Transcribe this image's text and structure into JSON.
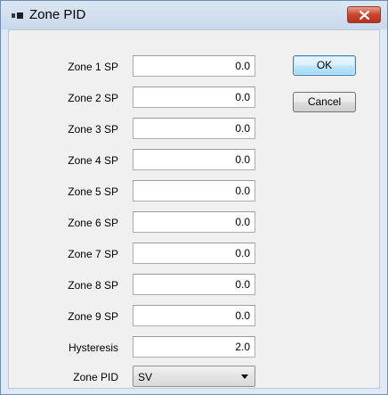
{
  "window": {
    "title": "Zone PID",
    "icon": "app-icon",
    "close_icon": "close-icon"
  },
  "form": {
    "rows": [
      {
        "label": "Zone 1 SP",
        "value": "0.0"
      },
      {
        "label": "Zone 2 SP",
        "value": "0.0"
      },
      {
        "label": "Zone 3 SP",
        "value": "0.0"
      },
      {
        "label": "Zone 4 SP",
        "value": "0.0"
      },
      {
        "label": "Zone 5 SP",
        "value": "0.0"
      },
      {
        "label": "Zone 6 SP",
        "value": "0.0"
      },
      {
        "label": "Zone 7 SP",
        "value": "0.0"
      },
      {
        "label": "Zone 8 SP",
        "value": "0.0"
      },
      {
        "label": "Zone 9 SP",
        "value": "0.0"
      },
      {
        "label": "Hysteresis",
        "value": "2.0"
      }
    ],
    "zone_pid": {
      "label": "Zone PID",
      "selected": "SV"
    }
  },
  "buttons": {
    "ok": "OK",
    "cancel": "Cancel"
  },
  "colors": {
    "close_button": "#c9442c",
    "title_bar": "#c9d9ec",
    "client_background": "#f0f0f0"
  }
}
